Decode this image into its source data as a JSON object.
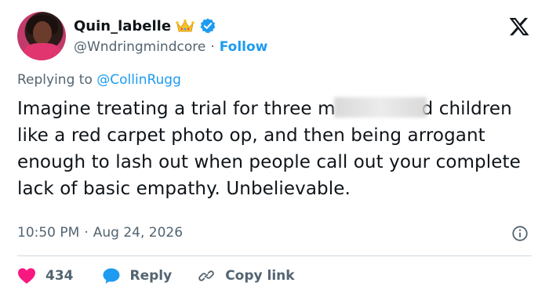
{
  "author": {
    "display_name": "Quin_labelle",
    "handle": "@Wndringmindcore",
    "follow_label": "Follow",
    "separator": "·"
  },
  "reply": {
    "prefix": "Replying to",
    "mention": "@CollinRugg"
  },
  "tweet": {
    "text_part1": "Imagine treating a trial for three m",
    "text_part2": "d children like a red carpet photo op, and then being arrogant enough to lash out when people call out your complete lack of basic empathy. Unbelievable.",
    "time": "10:50 PM",
    "separator": "·",
    "date": "Aug 24, 2026"
  },
  "actions": {
    "like_count": "434",
    "reply_label": "Reply",
    "copy_link_label": "Copy link"
  },
  "icons": {
    "brand": "x-logo-icon",
    "verified": "verified-badge-icon",
    "crown": "crown-emoji-icon",
    "info": "info-icon",
    "like": "heart-icon",
    "reply": "speech-bubble-icon",
    "copy": "link-icon"
  },
  "colors": {
    "accent": "#1d9bf0",
    "like": "#f91880",
    "muted": "#536471",
    "text": "#0f1419"
  }
}
